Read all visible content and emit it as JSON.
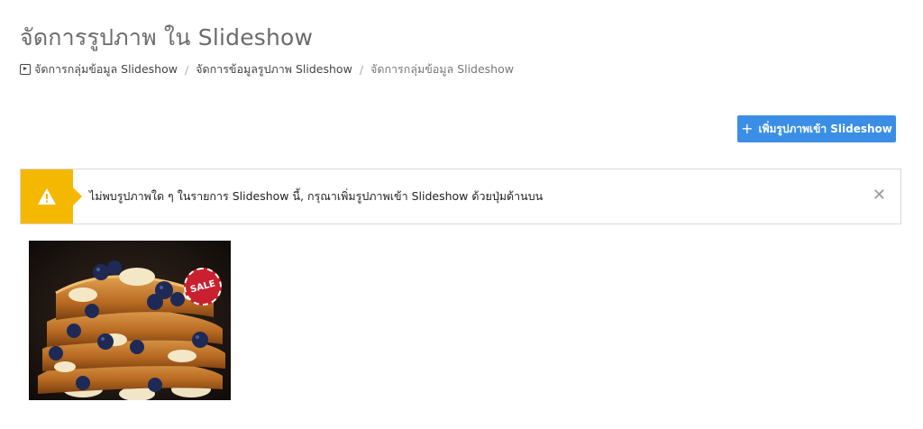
{
  "page": {
    "title": "จัดการรูปภาพ ใน Slideshow"
  },
  "breadcrumb": {
    "icon": "play-square-icon",
    "items": [
      {
        "label": "จัดการกลุ่มข้อมูล Slideshow"
      },
      {
        "label": "จัดการข้อมูลรูปภาพ Slideshow"
      },
      {
        "label": "จัดการกลุ่มข้อมูล Slideshow"
      }
    ],
    "separator": "/"
  },
  "toolbar": {
    "add_icon": "plus-icon",
    "add_label": "เพิ่มรูปภาพเข้า Slideshow",
    "add_color": "#3a8ee6"
  },
  "alert": {
    "icon": "warning-icon",
    "color": "#f5b800",
    "message": "ไม่พบรูปภาพใด ๆ ในรายการ Slideshow นี้, กรุณาเพิ่มรูปภาพเข้า Slideshow ด้วยปุ่มด้านบน",
    "close_icon": "close-icon",
    "close_glyph": "✕"
  },
  "gallery": {
    "items": [
      {
        "subject": "french toast with blueberries and bananas",
        "badge_text": "SALE",
        "badge_color": "#c8202e"
      }
    ]
  }
}
